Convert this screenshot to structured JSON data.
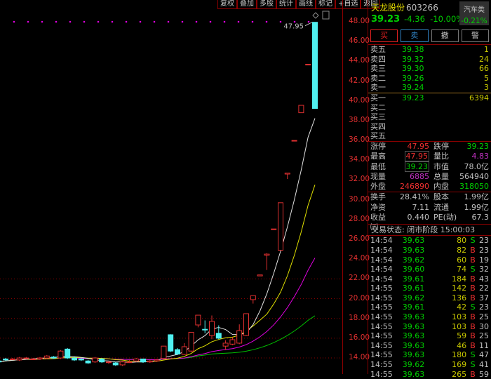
{
  "toolbar": [
    "复权",
    "叠加",
    "多股",
    "统计",
    "画线",
    "标记",
    "+自选",
    "返回"
  ],
  "stock": {
    "name": "天龙股份",
    "code": "603266",
    "price": "39.23",
    "change": "-4.36",
    "pct": "-10.00%"
  },
  "sector": {
    "name": "汽车类",
    "pct": "-0.21%"
  },
  "actions": {
    "buy": "买",
    "sell": "卖",
    "cancel": "撤",
    "alert": "警"
  },
  "asks": [
    {
      "label": "卖五",
      "price": "39.38",
      "vol": "1"
    },
    {
      "label": "卖四",
      "price": "39.32",
      "vol": "24"
    },
    {
      "label": "卖三",
      "price": "39.30",
      "vol": "66"
    },
    {
      "label": "卖二",
      "price": "39.26",
      "vol": "5"
    },
    {
      "label": "卖一",
      "price": "39.24",
      "vol": "3"
    }
  ],
  "bids": [
    {
      "label": "买一",
      "price": "39.23",
      "vol": "6394"
    },
    {
      "label": "买二",
      "price": "",
      "vol": ""
    },
    {
      "label": "买三",
      "price": "",
      "vol": ""
    },
    {
      "label": "买四",
      "price": "",
      "vol": ""
    },
    {
      "label": "买五",
      "price": "",
      "vol": ""
    }
  ],
  "stats": [
    {
      "k": "涨停",
      "v": "47.95",
      "k2": "跌停",
      "v2": "39.23"
    },
    {
      "k": "最高",
      "v": "47.95",
      "k2": "量比",
      "v2": "4.83"
    },
    {
      "k": "最低",
      "v": "39.23",
      "k2": "市值",
      "v2": "78.0亿"
    },
    {
      "k": "现量",
      "v": "6885",
      "k2": "总量",
      "v2": "564940"
    },
    {
      "k": "外盘",
      "v": "246890",
      "k2": "内盘",
      "v2": "318050"
    }
  ],
  "fund": [
    {
      "k": "换手",
      "v": "28.41%",
      "k2": "股本",
      "v2": "1.99亿"
    },
    {
      "k": "净资",
      "v": "7.11",
      "k2": "流通",
      "v2": "1.99亿"
    },
    {
      "k": "收益㈢",
      "v": "0.440",
      "k2": "PE(动)",
      "v2": "67.3"
    }
  ],
  "status": "交易状态: 闭市阶段 15:00:03",
  "trades": [
    [
      "14:54",
      "39.63",
      "80",
      "S",
      "23"
    ],
    [
      "14:54",
      "39.63",
      "82",
      "B",
      "23"
    ],
    [
      "14:54",
      "39.62",
      "60",
      "B",
      "19"
    ],
    [
      "14:54",
      "39.60",
      "74",
      "S",
      "32"
    ],
    [
      "14:54",
      "39.61",
      "184",
      "B",
      "43"
    ],
    [
      "14:55",
      "39.61",
      "142",
      "B",
      "22"
    ],
    [
      "14:55",
      "39.62",
      "136",
      "B",
      "37"
    ],
    [
      "14:55",
      "39.61",
      "42",
      "S",
      "23"
    ],
    [
      "14:55",
      "39.63",
      "103",
      "B",
      "25"
    ],
    [
      "14:55",
      "39.63",
      "103",
      "B",
      "30"
    ],
    [
      "14:55",
      "39.63",
      "59",
      "B",
      "25"
    ],
    [
      "14:55",
      "39.63",
      "46",
      "B",
      "11"
    ],
    [
      "14:55",
      "39.63",
      "180",
      "S",
      "47"
    ],
    [
      "14:55",
      "39.62",
      "169",
      "S",
      "41"
    ],
    [
      "14:55",
      "39.63",
      "265",
      "B",
      "59"
    ]
  ],
  "chart_data": {
    "type": "candlestick",
    "y_ticks": [
      "48.00",
      "46.00",
      "44.00",
      "42.00",
      "40.00",
      "38.00",
      "36.00",
      "34.00",
      "32.00",
      "30.00",
      "28.00",
      "26.00",
      "24.00",
      "22.00",
      "20.00",
      "18.00",
      "16.00",
      "14.00"
    ],
    "ylim": [
      14,
      48
    ],
    "high_label": "47.95",
    "colors": {
      "up": "#e03030",
      "down": "#50f0f0",
      "ma5": "#e0e0e0",
      "ma10": "#e0e000",
      "ma20": "#e000e0",
      "ma60": "#00c000"
    },
    "ohlc": [
      [
        13.7,
        13.6,
        14.0,
        13.5
      ],
      [
        13.9,
        13.8,
        14.0,
        13.7
      ],
      [
        13.9,
        13.9,
        14.0,
        13.8
      ],
      [
        13.8,
        14.0,
        14.1,
        13.7
      ],
      [
        14.0,
        14.0,
        14.1,
        13.9
      ],
      [
        13.9,
        13.9,
        14.0,
        13.8
      ],
      [
        13.9,
        14.0,
        14.1,
        13.8
      ],
      [
        14.0,
        14.2,
        14.3,
        13.9
      ],
      [
        14.1,
        14.0,
        14.2,
        13.9
      ],
      [
        14.0,
        14.7,
        14.8,
        13.9
      ],
      [
        14.9,
        14.0,
        15.0,
        13.9
      ],
      [
        14.0,
        13.8,
        14.1,
        13.7
      ],
      [
        13.9,
        13.8,
        14.0,
        13.7
      ],
      [
        13.7,
        13.5,
        13.8,
        13.4
      ],
      [
        13.6,
        14.0,
        14.1,
        13.5
      ],
      [
        13.9,
        13.6,
        14.0,
        13.5
      ],
      [
        13.6,
        13.6,
        13.7,
        13.4
      ],
      [
        13.5,
        13.3,
        13.6,
        13.2
      ],
      [
        13.3,
        13.6,
        13.7,
        13.2
      ],
      [
        13.6,
        13.6,
        13.8,
        13.5
      ],
      [
        13.7,
        13.9,
        14.0,
        13.6
      ],
      [
        13.9,
        13.6,
        13.9,
        13.5
      ],
      [
        13.6,
        13.7,
        13.8,
        13.5
      ],
      [
        13.7,
        13.8,
        13.9,
        13.6
      ],
      [
        13.95,
        15.2,
        15.2,
        13.9
      ],
      [
        16.35,
        14.7,
        16.4,
        14.6
      ],
      [
        14.85,
        14.4,
        15.0,
        14.3
      ],
      [
        14.36,
        15.14,
        15.5,
        14.3
      ],
      [
        14.7,
        16.6,
        16.6,
        14.6
      ],
      [
        17.34,
        18.33,
        18.33,
        17.1
      ],
      [
        16.9,
        16.84,
        17.8,
        16.5
      ],
      [
        16.27,
        17.7,
        18.3,
        15.9
      ],
      [
        16.5,
        16.0,
        17.3,
        15.9
      ],
      [
        15.2,
        15.5,
        15.8,
        14.8
      ],
      [
        15.4,
        15.85,
        16.1,
        15.3
      ],
      [
        15.5,
        16.77,
        17.4,
        15.4
      ],
      [
        16.27,
        18.48,
        18.48,
        16.2
      ],
      [
        19.9,
        20.3,
        20.3,
        19.5
      ],
      [
        22.3,
        22.4,
        22.4,
        22.3
      ],
      [
        24.4,
        24.5,
        24.6,
        22.9
      ],
      [
        27.0,
        27.05,
        27.05,
        27.0
      ],
      [
        24.9,
        29.7,
        29.7,
        24.9
      ],
      [
        32.6,
        32.7,
        32.7,
        32.1
      ],
      [
        36.0,
        36.0,
        36.0,
        36.0
      ],
      [
        38.8,
        39.55,
        39.55,
        38.8
      ],
      [
        43.7,
        43.7,
        43.7,
        43.7
      ],
      [
        47.95,
        39.23,
        47.95,
        39.23
      ]
    ]
  }
}
